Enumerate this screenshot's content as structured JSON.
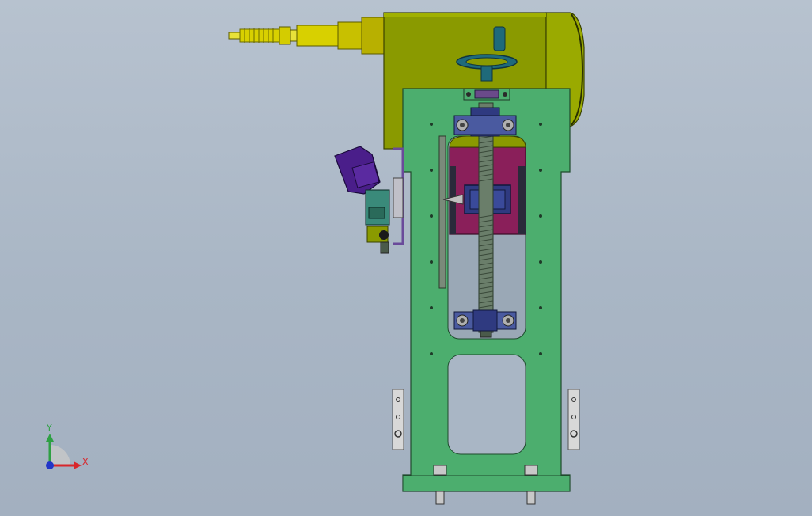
{
  "viewport": {
    "background": "#aab6c5"
  },
  "triad": {
    "x_label": "X",
    "y_label": "Y",
    "x_color": "#d8262b",
    "y_color": "#2ea043",
    "z_color": "#2236c8"
  },
  "model": {
    "housing_color": "#8a9a00",
    "frame_color": "#4cae6e",
    "carriage_color": "#8a1f5a",
    "screw_color": "#6a7e6a",
    "bracket_color": "#2f3a80",
    "nozzle_color": "#d8d000",
    "valve_color": "#4a1e8a",
    "handwheel_color": "#1f6a7a",
    "slot_color": "#9aa8b6"
  }
}
